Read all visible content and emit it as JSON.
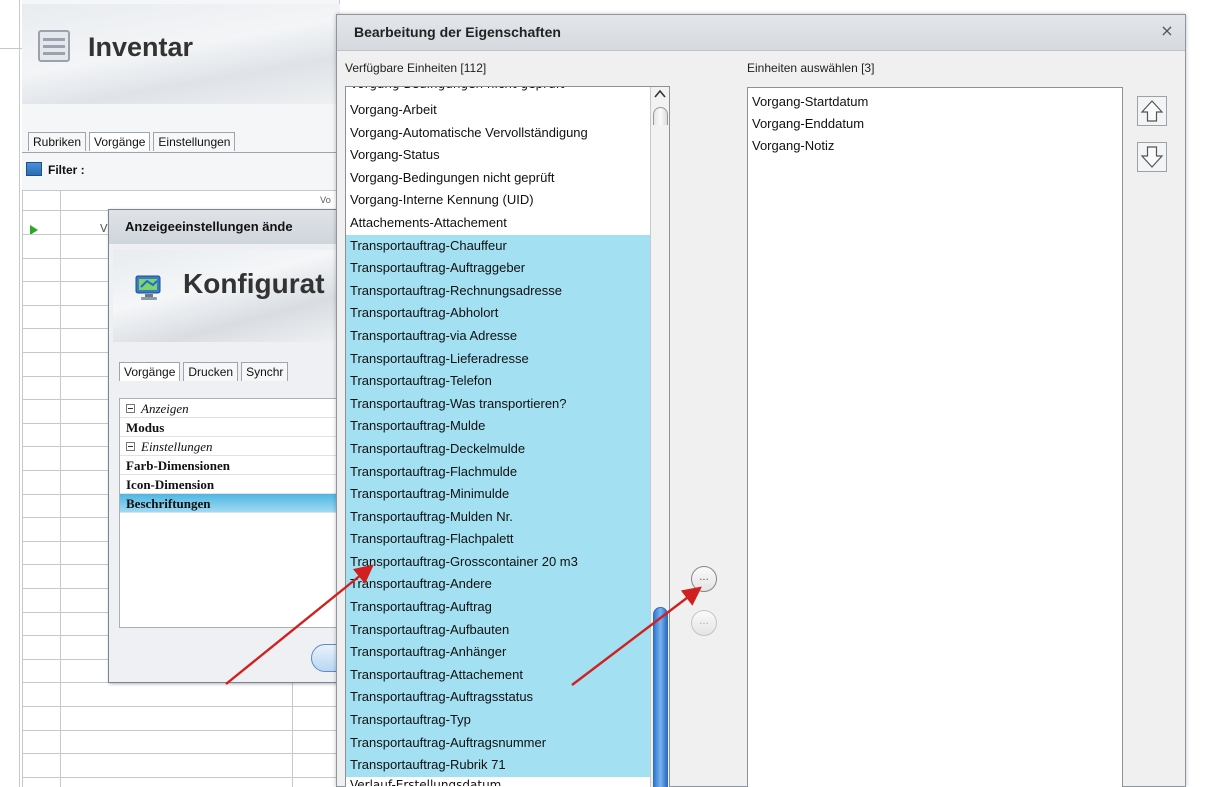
{
  "background_window": {
    "title": "Inventar",
    "tabs": [
      "Rubriken",
      "Vorgänge",
      "Einstellungen"
    ],
    "filter_label": "Filter :",
    "column_fragment": "Vo",
    "row_fragment": "V"
  },
  "settings_window": {
    "title": "Anzeigeeinstellungen ände",
    "header": "Konfigurat",
    "tabs": [
      "Vorgänge",
      "Drucken",
      "Synchr"
    ],
    "properties": [
      {
        "label": "Anzeigen",
        "kind": "category"
      },
      {
        "label": "Modus",
        "kind": "property"
      },
      {
        "label": "Einstellungen",
        "kind": "category"
      },
      {
        "label": "Farb-Dimensionen",
        "kind": "property"
      },
      {
        "label": "Icon-Dimension",
        "kind": "property"
      },
      {
        "label": "Beschriftungen",
        "kind": "selected"
      }
    ]
  },
  "dialog": {
    "title": "Bearbeitung der Eigenschaften",
    "close_glyph": "×",
    "available_label": "Verfügbare Einheiten [112]",
    "selected_label": "Einheiten auswählen [3]",
    "available_items": [
      {
        "text": "Vorgang-Arbeit",
        "highlighted": false
      },
      {
        "text": "Vorgang-Automatische Vervollständigung",
        "highlighted": false
      },
      {
        "text": "Vorgang-Status",
        "highlighted": false
      },
      {
        "text": "Vorgang-Bedingungen nicht geprüft",
        "highlighted": false
      },
      {
        "text": "Vorgang-Interne Kennung (UID)",
        "highlighted": false
      },
      {
        "text": "Attachements-Attachement",
        "highlighted": false
      },
      {
        "text": "Transportauftrag-Chauffeur",
        "highlighted": true
      },
      {
        "text": "Transportauftrag-Auftraggeber",
        "highlighted": true
      },
      {
        "text": "Transportauftrag-Rechnungsadresse",
        "highlighted": true
      },
      {
        "text": "Transportauftrag-Abholort",
        "highlighted": true
      },
      {
        "text": "Transportauftrag-via Adresse",
        "highlighted": true
      },
      {
        "text": "Transportauftrag-Lieferadresse",
        "highlighted": true
      },
      {
        "text": "Transportauftrag-Telefon",
        "highlighted": true
      },
      {
        "text": "Transportauftrag-Was transportieren?",
        "highlighted": true
      },
      {
        "text": "Transportauftrag-Mulde",
        "highlighted": true
      },
      {
        "text": "Transportauftrag-Deckelmulde",
        "highlighted": true
      },
      {
        "text": "Transportauftrag-Flachmulde",
        "highlighted": true
      },
      {
        "text": "Transportauftrag-Minimulde",
        "highlighted": true
      },
      {
        "text": "Transportauftrag-Mulden Nr.",
        "highlighted": true
      },
      {
        "text": "Transportauftrag-Flachpalett",
        "highlighted": true
      },
      {
        "text": "Transportauftrag-Grosscontainer 20 m3",
        "highlighted": true
      },
      {
        "text": "Transportauftrag-Andere",
        "highlighted": true
      },
      {
        "text": "Transportauftrag-Auftrag",
        "highlighted": true
      },
      {
        "text": "Transportauftrag-Aufbauten",
        "highlighted": true
      },
      {
        "text": "Transportauftrag-Anhänger",
        "highlighted": true
      },
      {
        "text": "Transportauftrag-Attachement",
        "highlighted": true
      },
      {
        "text": "Transportauftrag-Auftragsstatus",
        "highlighted": true
      },
      {
        "text": "Transportauftrag-Typ",
        "highlighted": true
      },
      {
        "text": "Transportauftrag-Auftragsnummer",
        "highlighted": true
      },
      {
        "text": "Transportauftrag-Rubrik 71",
        "highlighted": true
      }
    ],
    "selected_items": [
      "Vorgang-Startdatum",
      "Vorgang-Enddatum",
      "Vorgang-Notiz"
    ],
    "add_button_glyph": "...",
    "remove_button_glyph": "..."
  },
  "icons": {
    "up": "up-arrow-icon",
    "down": "down-arrow-icon",
    "close": "close-icon"
  },
  "colors": {
    "highlight": "#a3e0f1",
    "annotation_arrow": "#d0201f",
    "selected_property": "#4fb6e0"
  }
}
